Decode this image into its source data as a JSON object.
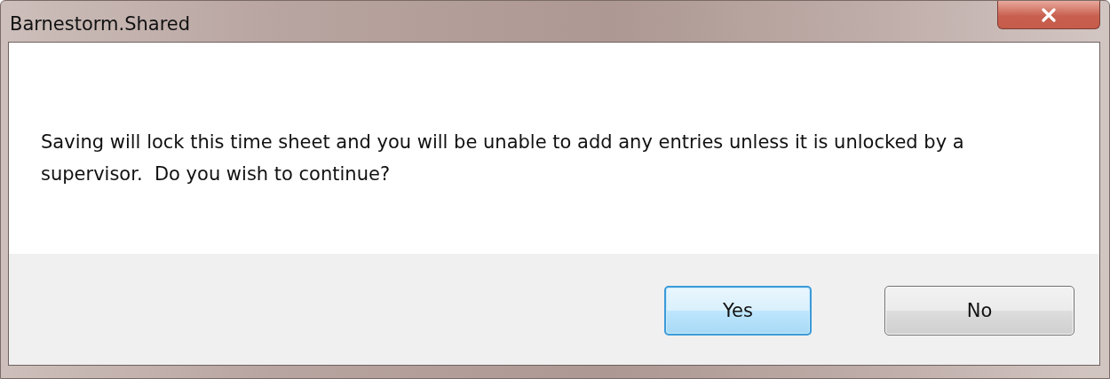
{
  "window": {
    "title": "Barnestorm.Shared"
  },
  "message": "Saving will lock this time sheet and you will be unable to add any entries unless it is unlocked by a supervisor.  Do you wish to continue?",
  "buttons": [
    {
      "label": "Yes",
      "default": true
    },
    {
      "label": "No",
      "default": false
    }
  ]
}
